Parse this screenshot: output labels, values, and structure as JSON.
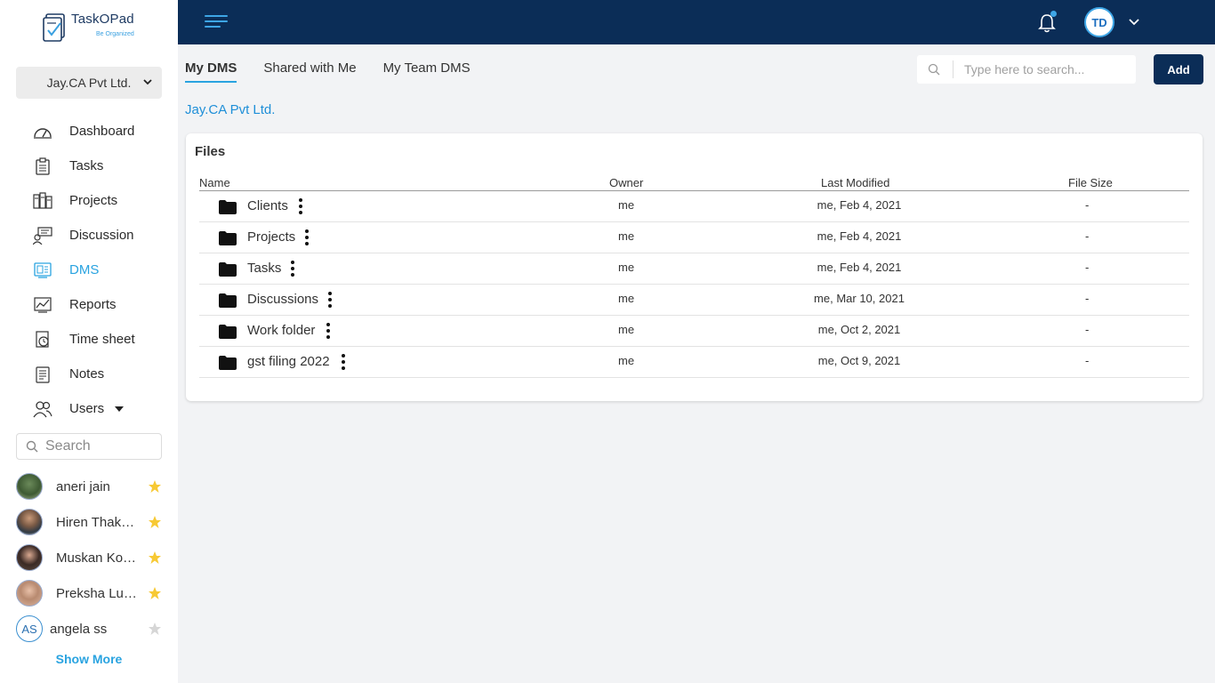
{
  "app": {
    "logo_title": "TaskOPad",
    "logo_tagline": "Be Organized"
  },
  "org": {
    "selected": "Jay.CA Pvt Ltd."
  },
  "nav": [
    {
      "label": "Dashboard",
      "icon": "dashboard-icon"
    },
    {
      "label": "Tasks",
      "icon": "tasks-icon"
    },
    {
      "label": "Projects",
      "icon": "projects-icon"
    },
    {
      "label": "Discussion",
      "icon": "discussion-icon"
    },
    {
      "label": "DMS",
      "icon": "dms-icon",
      "active": true
    },
    {
      "label": "Reports",
      "icon": "reports-icon"
    },
    {
      "label": "Time sheet",
      "icon": "timesheet-icon"
    },
    {
      "label": "Notes",
      "icon": "notes-icon"
    },
    {
      "label": "Users",
      "icon": "users-icon"
    }
  ],
  "sidebar_search": {
    "placeholder": "Search"
  },
  "users": [
    {
      "name": "aneri jain",
      "starred": true
    },
    {
      "name": "Hiren Thakker",
      "starred": true
    },
    {
      "name": "Muskan Kothari",
      "starred": true
    },
    {
      "name": "Preksha Lunia",
      "starred": true
    },
    {
      "name": "angela ss",
      "initials": "AS",
      "starred": false
    }
  ],
  "show_more": "Show More",
  "topbar": {
    "profile_initials": "TD"
  },
  "tabs": [
    "My DMS",
    "Shared with Me",
    "My Team DMS"
  ],
  "search": {
    "placeholder": "Type here to search..."
  },
  "add_button": "Add",
  "breadcrumb": "Jay.CA Pvt Ltd.",
  "files": {
    "title": "Files",
    "columns": {
      "name": "Name",
      "owner": "Owner",
      "modified": "Last Modified",
      "size": "File Size"
    },
    "rows": [
      {
        "name": "Clients",
        "owner": "me",
        "modified": "me, Feb 4, 2021",
        "size": "-"
      },
      {
        "name": "Projects",
        "owner": "me",
        "modified": "me, Feb 4, 2021",
        "size": "-"
      },
      {
        "name": "Tasks",
        "owner": "me",
        "modified": "me, Feb 4, 2021",
        "size": "-"
      },
      {
        "name": "Discussions",
        "owner": "me",
        "modified": "me, Mar 10, 2021",
        "size": "-"
      },
      {
        "name": "Work folder",
        "owner": "me",
        "modified": "me, Oct 2, 2021",
        "size": "-"
      },
      {
        "name": "gst filing 2022",
        "owner": "me",
        "modified": "me, Oct 9, 2021",
        "size": "-"
      }
    ]
  },
  "colors": {
    "navy": "#0b2d57",
    "accent": "#29a3e0",
    "star": "#f7c934"
  }
}
